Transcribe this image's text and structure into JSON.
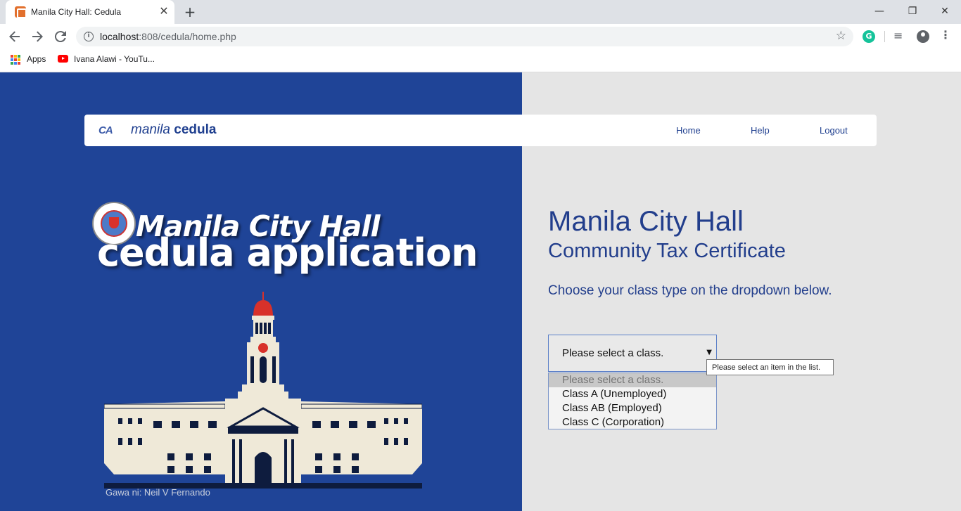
{
  "browser": {
    "tab_title": "Manila City Hall: Cedula",
    "tab_close": "✕",
    "new_tab": "+",
    "url_host": "localhost",
    "url_rest": ":808/cedula/home.php",
    "window_controls": {
      "minimize": "—",
      "restore": "❐",
      "close": "✕"
    },
    "bookmarks": [
      {
        "label": "Apps"
      },
      {
        "label": "Ivana Alawi - YouTu..."
      }
    ],
    "icons": {
      "back": "arrow-left-icon",
      "forward": "arrow-right-icon",
      "reload": "reload-icon",
      "info": "info-icon",
      "star": "star-icon",
      "grammarly": "grammarly-icon",
      "media": "media-control-icon",
      "profile": "profile-icon",
      "menu": "kebab-menu-icon"
    }
  },
  "navbar": {
    "logo": "CA",
    "brand_light": "manila",
    "brand_bold": "cedula",
    "links": [
      "Home",
      "Help",
      "Logout"
    ]
  },
  "hero": {
    "title": "Manila City Hall",
    "subtitle": "cedula application",
    "credit": "Gawa ni: Neil V Fernando",
    "colors": {
      "panel": "#1f4497",
      "building": "#efe9d8",
      "dome": "#d8312a"
    }
  },
  "content": {
    "title": "Manila City Hall",
    "subtitle": "Community Tax Certificate",
    "description": "Choose your class type on the dropdown below."
  },
  "class_select": {
    "value": "Please select a class.",
    "options": [
      "Please select a class.",
      "Class A (Unemployed)",
      "Class AB (Employed)",
      "Class C (Corporation)"
    ],
    "validation_tooltip": "Please select an item in the list."
  }
}
